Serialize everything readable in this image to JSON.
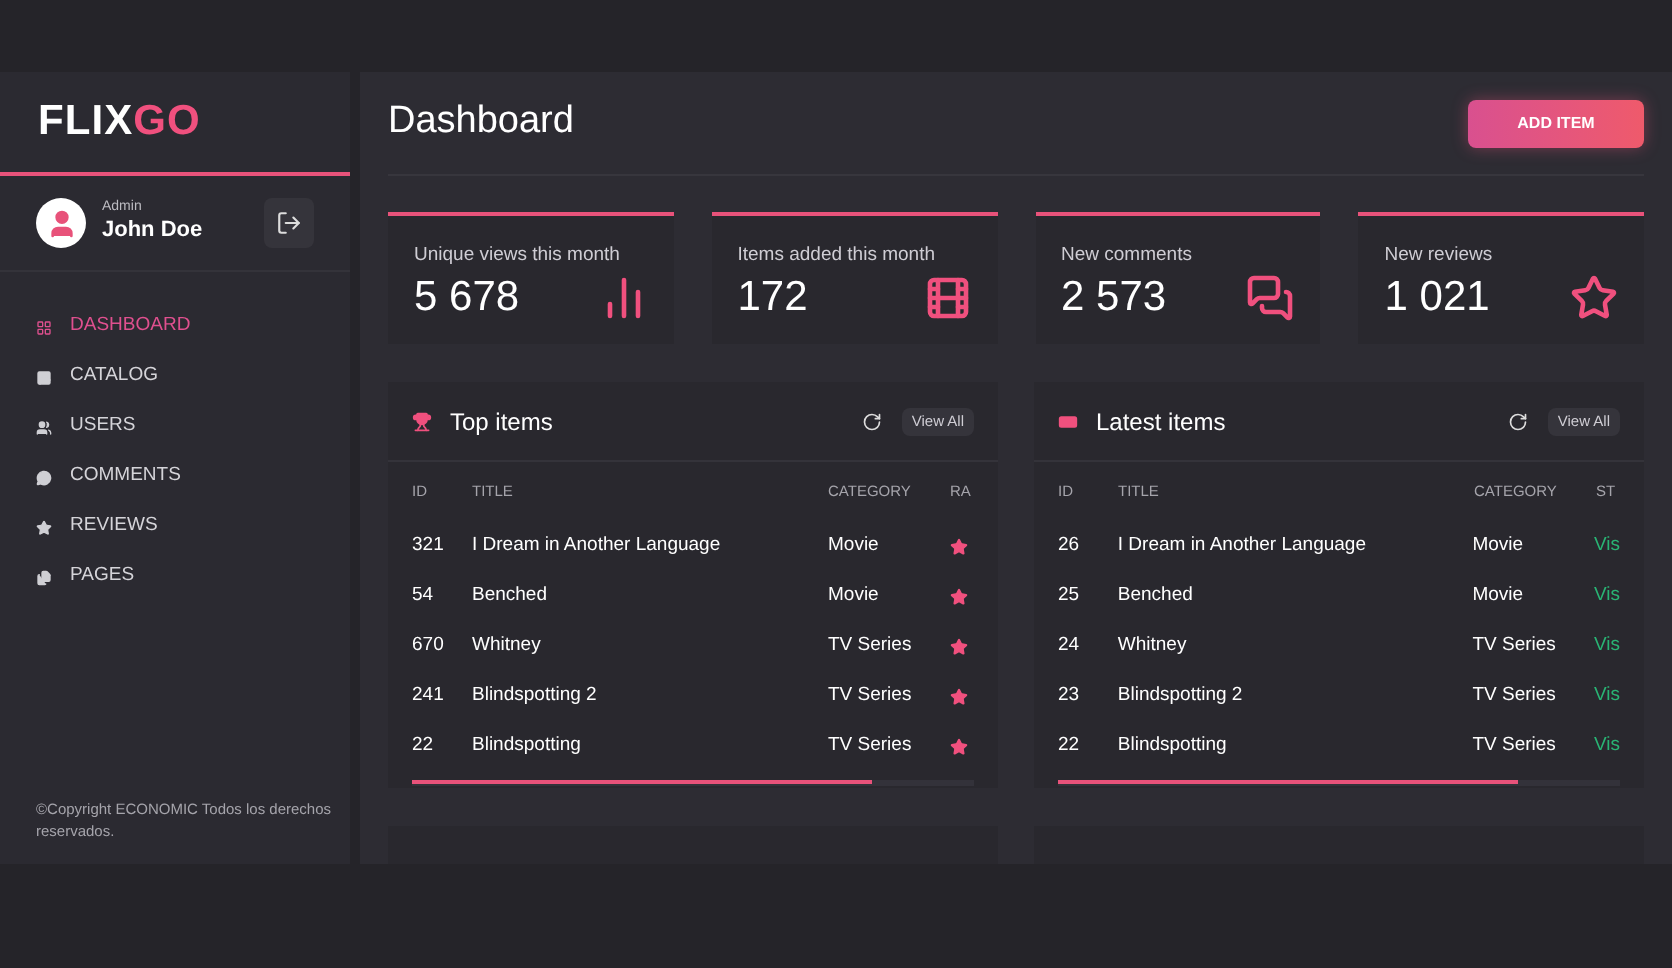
{
  "sidebar": {
    "logo": {
      "part1": "FLIX",
      "part2": "GO"
    },
    "user": {
      "role": "Admin",
      "name": "John Doe"
    },
    "items": [
      {
        "label": "DASHBOARD",
        "selected": true
      },
      {
        "label": "CATALOG",
        "selected": false
      },
      {
        "label": "USERS",
        "selected": false
      },
      {
        "label": "COMMENTS",
        "selected": false
      },
      {
        "label": "REVIEWS",
        "selected": false
      },
      {
        "label": "PAGES",
        "selected": false
      }
    ],
    "copyright": "©Copyright ECONOMIC Todos los derechos reservados."
  },
  "header": {
    "title": "Dashboard",
    "button": "ADD ITEM"
  },
  "stats": [
    {
      "label": "Unique views this month",
      "value": "5 678"
    },
    {
      "label": "Items added this month",
      "value": "172"
    },
    {
      "label": "New comments",
      "value": "2 573"
    },
    {
      "label": "New reviews",
      "value": "1 021"
    }
  ],
  "panels": [
    {
      "title": "Top items",
      "button": "View All",
      "columns": [
        "ID",
        "TITLE",
        "CATEGORY",
        "RA"
      ],
      "rows": [
        {
          "id": "321",
          "title": "I Dream in Another Language",
          "category": "Movie"
        },
        {
          "id": "54",
          "title": "Benched",
          "category": "Movie"
        },
        {
          "id": "670",
          "title": "Whitney",
          "category": "TV Series"
        },
        {
          "id": "241",
          "title": "Blindspotting 2",
          "category": "TV Series"
        },
        {
          "id": "22",
          "title": "Blindspotting",
          "category": "TV Series"
        }
      ]
    },
    {
      "title": "Latest items",
      "button": "View All",
      "columns": [
        "ID",
        "TITLE",
        "CATEGORY",
        "ST"
      ],
      "rows": [
        {
          "id": "26",
          "title": "I Dream in Another Language",
          "category": "Movie",
          "status": "Vis"
        },
        {
          "id": "25",
          "title": "Benched",
          "category": "Movie",
          "status": "Vis"
        },
        {
          "id": "24",
          "title": "Whitney",
          "category": "TV Series",
          "status": "Vis"
        },
        {
          "id": "23",
          "title": "Blindspotting 2",
          "category": "TV Series",
          "status": "Vis"
        },
        {
          "id": "22",
          "title": "Blindspotting",
          "category": "TV Series",
          "status": "Vis"
        }
      ]
    }
  ]
}
